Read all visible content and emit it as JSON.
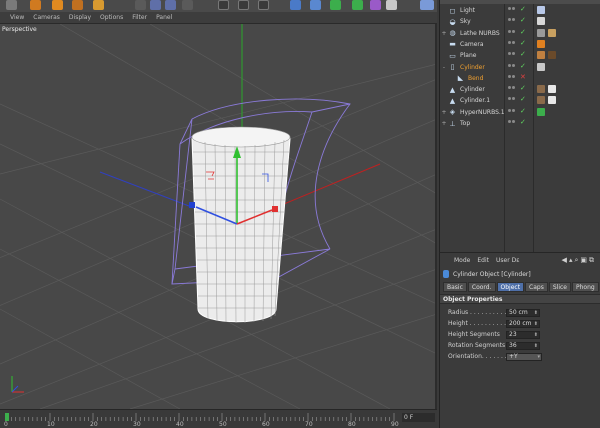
{
  "viewport_menu": [
    "View",
    "Cameras",
    "Display",
    "Options",
    "Filter",
    "Panel"
  ],
  "viewport": {
    "label": "Perspective"
  },
  "timeline": {
    "ticks": [
      "0",
      "10",
      "20",
      "30",
      "40",
      "50",
      "60",
      "70",
      "80",
      "90"
    ],
    "frame": "0 F"
  },
  "object_manager": {
    "objects": [
      {
        "name": "Light",
        "icon": "light-icon",
        "depth": 0,
        "expander": ""
      },
      {
        "name": "Sky",
        "icon": "sky-icon",
        "depth": 0,
        "expander": ""
      },
      {
        "name": "Lathe NURBS",
        "icon": "lathe-nurbs-icon",
        "depth": 0,
        "expander": "+"
      },
      {
        "name": "Camera",
        "icon": "camera-icon",
        "depth": 0,
        "expander": ""
      },
      {
        "name": "Plane",
        "icon": "plane-icon",
        "depth": 0,
        "expander": ""
      },
      {
        "name": "Cylinder",
        "icon": "cylinder-icon",
        "depth": 0,
        "expander": "-",
        "selected": true
      },
      {
        "name": "Bend",
        "icon": "bend-icon",
        "depth": 1,
        "expander": "",
        "selected": true
      },
      {
        "name": "Cylinder",
        "icon": "cone-icon",
        "depth": 0,
        "expander": ""
      },
      {
        "name": "Cylinder.1",
        "icon": "cone-icon",
        "depth": 0,
        "expander": ""
      },
      {
        "name": "HyperNURBS.1",
        "icon": "hypernurbs-icon",
        "depth": 0,
        "expander": "+"
      },
      {
        "name": "Top",
        "icon": "null-icon",
        "depth": 0,
        "expander": "+"
      }
    ]
  },
  "attribute_manager": {
    "menu": [
      "Mode",
      "Edit",
      "User Dε"
    ],
    "title": "Cylinder Object [Cylinder]",
    "tabs": [
      "Basic",
      "Coord.",
      "Object",
      "Caps",
      "Slice",
      "Phong"
    ],
    "active_tab": "Object",
    "section": "Object Properties",
    "properties": [
      {
        "label": "Radius . . . . . . . . . . . .",
        "value": "50 cm"
      },
      {
        "label": "Height . . . . . . . . . . . .",
        "value": "200 cm"
      },
      {
        "label": "Height Segments",
        "value": "23"
      },
      {
        "label": "Rotation Segments",
        "value": "36"
      },
      {
        "label": "Orientation. . . . . . . . .",
        "value": "+Y"
      }
    ]
  },
  "colors": {
    "selected": "#f0a030",
    "accent": "#4e6fa8",
    "axis_x": "#e03030",
    "axis_y": "#30c030",
    "axis_z": "#3050e0"
  }
}
